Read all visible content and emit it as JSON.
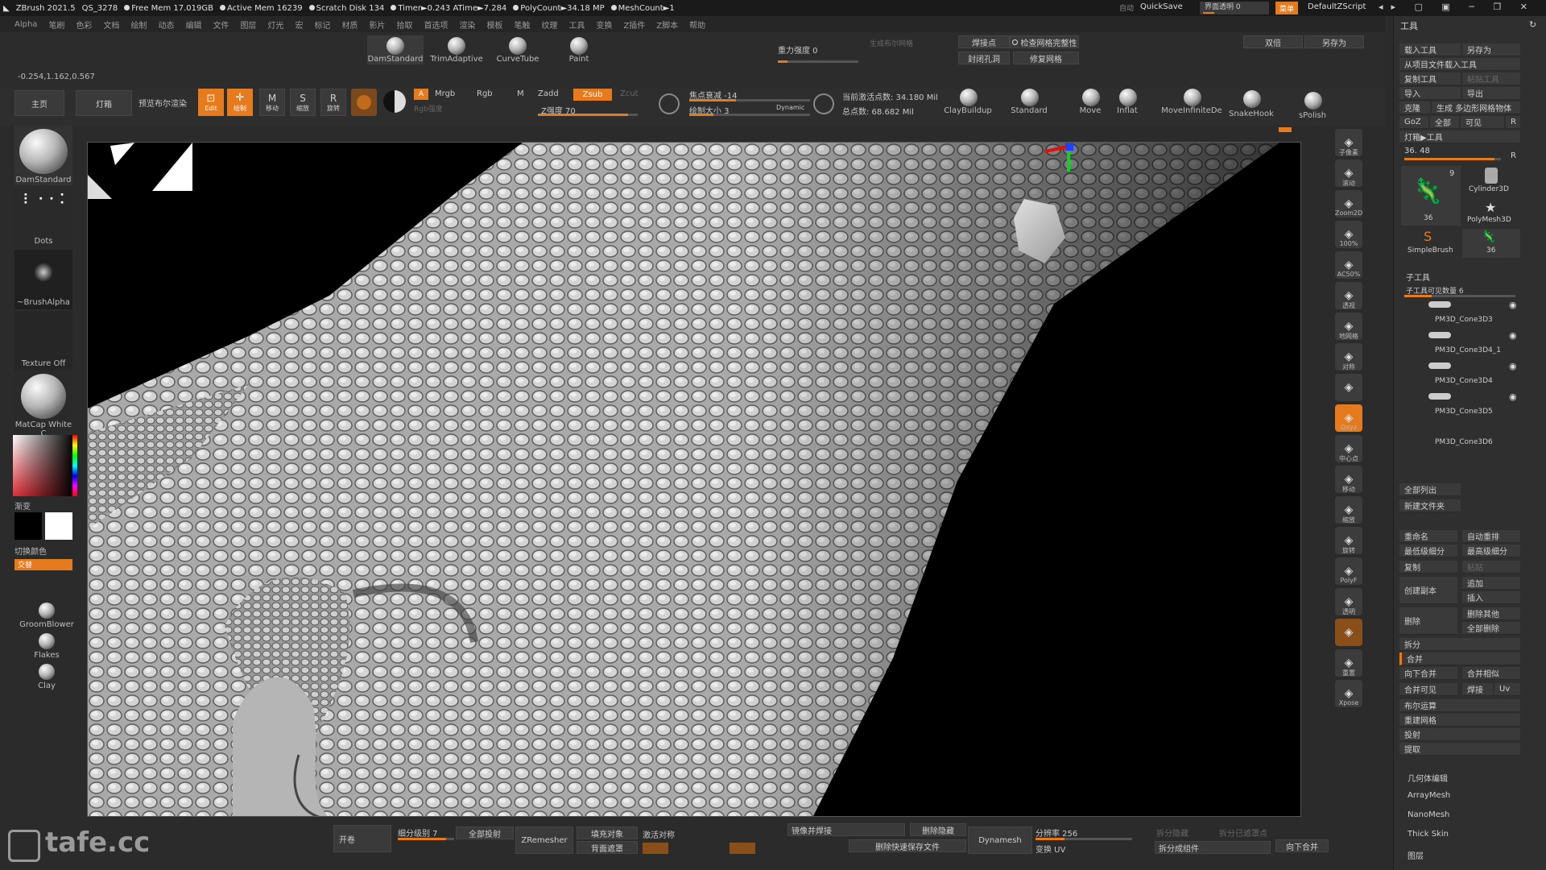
{
  "title_bar": {
    "app": "ZBrush 2021.5",
    "project": "QS_3278",
    "items": [
      "Free Mem 17.019GB",
      "Active Mem 16239",
      "Scratch Disk 134",
      "Timer►0.243 ATime►7.284",
      "PolyCount►34.18 MP",
      "MeshCount►1"
    ],
    "right_auto": "自动",
    "quicksave": "QuickSave",
    "transparency": "界面透明 0",
    "menu": "菜单",
    "script": "DefaultZScript"
  },
  "menu": [
    "Alpha",
    "笔刷",
    "色彩",
    "文档",
    "绘制",
    "动态",
    "编辑",
    "文件",
    "图层",
    "灯光",
    "宏",
    "标记",
    "材质",
    "影片",
    "拾取",
    "首选项",
    "渲染",
    "模板",
    "笔触",
    "纹理",
    "工具",
    "变换",
    "Z插件",
    "Z脚本",
    "帮助"
  ],
  "coords": "-0.254,1.162,0.567",
  "brushes_top": [
    {
      "label": "DamStandard"
    },
    {
      "label": "TrimAdaptive"
    },
    {
      "label": "CurveTube"
    },
    {
      "label": "Paint"
    }
  ],
  "gravity": "重力强度 0",
  "gen_mesh": "生成布尔网格",
  "weld_points": "焊接点",
  "check_mesh": "检查网格完整性",
  "close_holes": "封闭孔洞",
  "fix_mesh": "修复网格",
  "double": "双倍",
  "save_as": "另存为",
  "nav": {
    "home": "主页",
    "lightbox": "灯箱",
    "preview": "预览布尔渲染"
  },
  "toolbar_modes": [
    {
      "label": "Edit"
    },
    {
      "label": "绘制"
    },
    {
      "label": "移动"
    },
    {
      "label": "缩放"
    },
    {
      "label": "旋转"
    }
  ],
  "color_modes": {
    "a": "A",
    "mrgb": "Mrgb",
    "rgb": "Rgb",
    "m": "M",
    "rgb_intensity": "Rgb强度",
    "zadd": "Zadd",
    "zsub": "Zsub",
    "zcut": "Zcut",
    "z_intensity": "Z强度 70"
  },
  "focal": {
    "label": "焦点衰减 -14",
    "draw_size": "绘制大小 3",
    "dynamic": "Dynamic"
  },
  "points": {
    "active": "当前激活点数: 34.180 Mil",
    "total": "总点数: 68.682 Mil"
  },
  "brushes_right": [
    {
      "label": "ClayBuildup"
    },
    {
      "label": "Standard"
    },
    {
      "label": "Move"
    },
    {
      "label": "Inflat"
    },
    {
      "label": "MoveInfiniteDe"
    },
    {
      "label": "SnakeHook"
    },
    {
      "label": "sPolish"
    }
  ],
  "left_shelf": {
    "brush": "DamStandard",
    "stroke": "Dots",
    "alpha": "~BrushAlpha",
    "texture": "Texture Off",
    "material": "MatCap White C",
    "gradient": "渐变",
    "switch_color": "切换颜色",
    "alternate": "交替",
    "extra_brushes": [
      "GroomBlower",
      "Flakes",
      "Clay"
    ]
  },
  "right_shelf": [
    {
      "icon": "bpr-icon",
      "label": "子像素"
    },
    {
      "icon": "scroll-icon",
      "label": "滚动"
    },
    {
      "icon": "zoom2d-icon",
      "label": "Zoom2D"
    },
    {
      "icon": "100-icon",
      "label": "100%"
    },
    {
      "icon": "ac50-icon",
      "label": "AC50%"
    },
    {
      "icon": "persp-icon",
      "label": "透视"
    },
    {
      "icon": "floor-icon",
      "label": "地网格"
    },
    {
      "icon": "sym-icon",
      "label": "对称"
    },
    {
      "icon": "lock-icon",
      "label": ""
    },
    {
      "icon": "xyz-icon",
      "label": "Qxyz"
    },
    {
      "icon": "center-icon",
      "label": "中心点"
    },
    {
      "icon": "move-icon",
      "label": "移动"
    },
    {
      "icon": "scale-icon",
      "label": "缩放"
    },
    {
      "icon": "rotate-icon",
      "label": "旋转"
    },
    {
      "icon": "polyf-icon",
      "label": "PolyF"
    },
    {
      "icon": "transp-icon",
      "label": "透明"
    },
    {
      "icon": "solo-icon",
      "label": ""
    },
    {
      "icon": "dynamic-icon",
      "label": "重置"
    },
    {
      "icon": "xpose-icon",
      "label": "Xpose"
    }
  ],
  "tool_panel": {
    "header": "工具",
    "load_tool": "载入工具",
    "save_as": "另存为",
    "load_from_project": "从项目文件载入工具",
    "copy_tool": "复制工具",
    "paste_tool": "粘贴工具",
    "import": "导入",
    "export": "导出",
    "clone": "克隆",
    "make_polymesh": "生成 多边形网格物体",
    "goz": "GoZ",
    "all": "全部",
    "visible": "可见",
    "r": "R",
    "lightbox_tools": "灯箱▶工具",
    "value": "36. 48",
    "tools": [
      {
        "name": "",
        "count": "9"
      },
      {
        "name": "Cylinder3D",
        "count": ""
      },
      {
        "name": "",
        "count": "36"
      },
      {
        "name": "PolyMesh3D",
        "count": ""
      },
      {
        "name": "SimpleBrush",
        "count": ""
      },
      {
        "name": "",
        "count": "36"
      }
    ],
    "subtool_header": "子工具",
    "subtool_count": "子工具可见数量 6",
    "subtools": [
      "PM3D_Cone3D3",
      "PM3D_Cone3D4_1",
      "PM3D_Cone3D4",
      "PM3D_Cone3D5",
      "PM3D_Cone3D6"
    ],
    "list_all": "全部列出",
    "new_folder": "新建文件夹",
    "rename": "重命名",
    "auto_reorder": "自动重排",
    "lowest_subdiv": "最低级细分",
    "highest_subdiv": "最高级细分",
    "copy": "复制",
    "paste": "粘贴",
    "duplicate": "创建副本",
    "append": "追加",
    "insert": "插入",
    "delete": "删除",
    "delete_other": "删除其他",
    "delete_all": "全部删除",
    "split": "拆分",
    "merge": "合并",
    "merge_down": "向下合并",
    "merge_similar": "合并相似",
    "merge_visible": "合并可见",
    "weld": "焊接",
    "uv": "Uv",
    "boolean": "布尔运算",
    "remesh": "重建网格",
    "project": "投射",
    "extract": "提取",
    "geometry": "几何体编辑",
    "arraymesh": "ArrayMesh",
    "nanomesh": "NanoMesh",
    "thickskin": "Thick Skin",
    "layers": "图层"
  },
  "bottom": {
    "open": "开卷",
    "subdiv_level": "细分级别 7",
    "project_all": "全部投射",
    "zremesher": "ZRemesher",
    "fill_object": "填充对象",
    "backface_mask": "背面遮罩",
    "activate_sym": "激活对称",
    "mirror_weld": "镜像并焊接",
    "delete_hidden": "删除隐藏",
    "delete_quick_save": "删除快速保存文件",
    "dynamesh": "Dynamesh",
    "resolution": "分辨率 256",
    "transform_uv": "变换 UV",
    "split_hidden": "拆分隐藏",
    "split_unmasked": "拆分已遮罩点",
    "split_to_groups": "拆分成组件",
    "merge_down": "向下合并"
  },
  "watermark": "tafe.cc",
  "colors": {
    "accent": "#e57a1e",
    "panel": "#2f2f2f",
    "button": "#3a3a3a"
  }
}
